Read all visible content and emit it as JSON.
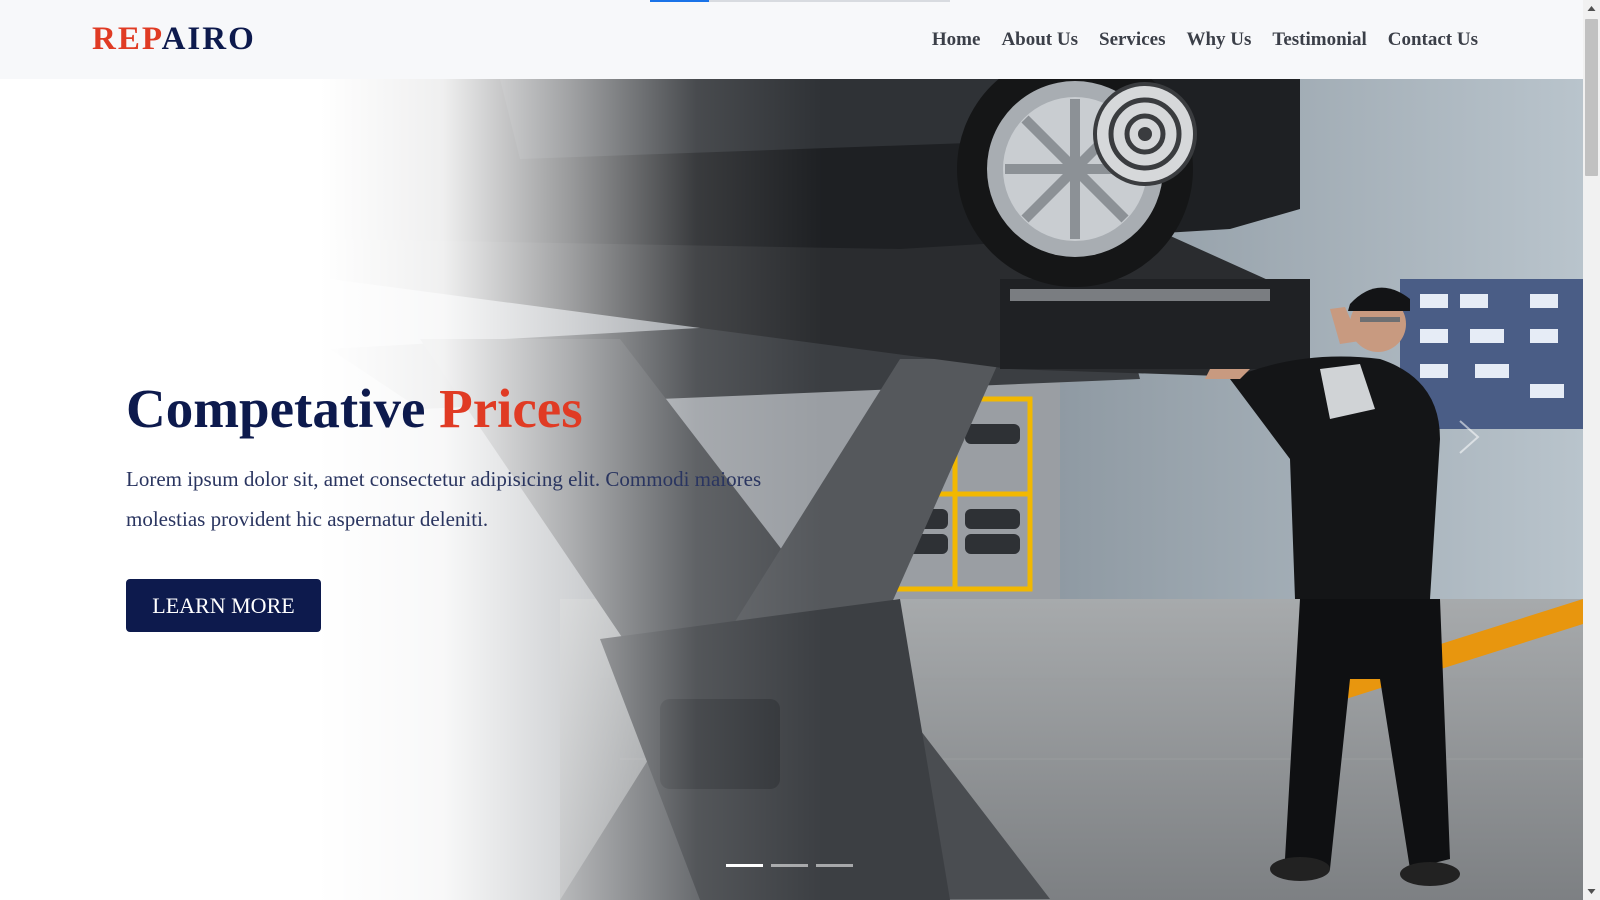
{
  "brand": {
    "logo_part1": "REP",
    "logo_part2": "AIRO",
    "logo_color_red": "#e03b24",
    "logo_color_navy": "#0d1a4d"
  },
  "nav": {
    "items": [
      {
        "label": "Home"
      },
      {
        "label": "About Us"
      },
      {
        "label": "Services"
      },
      {
        "label": "Why Us"
      },
      {
        "label": "Testimonial"
      },
      {
        "label": "Contact Us"
      }
    ]
  },
  "hero": {
    "title_part1": "Competative ",
    "title_part2": "Prices",
    "text": "Lorem ipsum dolor sit, amet consectetur adipisicing elit. Commodi maiores molestias provident hic aspernatur deleniti.",
    "button_label": "LEARN MORE",
    "slide_count": 3,
    "active_slide": 1,
    "image_subject": "mechanic checking wheel alignment on car raised on scissor lift"
  },
  "colors": {
    "accent": "#e03b24",
    "primary": "#0d1a4d",
    "header_bg": "#f7f8fa"
  }
}
